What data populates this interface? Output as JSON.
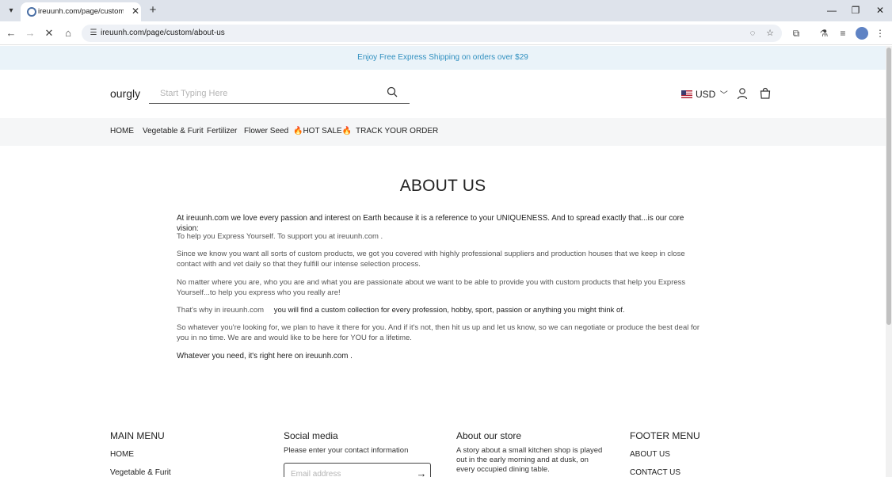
{
  "browser": {
    "tab_title": "ireuunh.com/page/custom/about-us",
    "url": "ireuunh.com/page/custom/about-us"
  },
  "announcement": "Enjoy Free Express Shipping on orders over $29",
  "header": {
    "logo": "ourgly",
    "search_placeholder": "Start Typing Here",
    "currency": "USD"
  },
  "nav": {
    "items": [
      "HOME",
      "Vegetable & Furit",
      "Fertilizer",
      "Flower Seed",
      "🔥HOT SALE🔥",
      "TRACK YOUR ORDER"
    ]
  },
  "about": {
    "title": "ABOUT US",
    "p1": "At ireuunh.com    we love every passion and interest on Earth because it is a reference to your UNIQUENESS.  And to spread exactly that...is  our core vision:",
    "p2": "To help you Express Yourself. To support you at ireuunh.com  .",
    "p3": "Since we know you want all sorts of custom products, we got  you covered with highly professional suppliers and production houses that we keep in close contact with and vet daily so that they fulfill our intense selection process.",
    "p4": "No matter where you are, who you are and what you are passionate about we want to be able to provide you with custom products that help you Express Yourself...to help you express who you really are!",
    "p5_prefix": "That's why in ireuunh.com",
    "p5_rest": "you will find a custom collection for every profession, hobby, sport, passion or anything you might think of.",
    "p6": "So whatever you're looking for, we plan to have it there for you. And if it's not, then hit us up and let us know, so we can negotiate or produce the best deal for you in no time. We are and would like to be here for YOU for a lifetime.",
    "p7": "Whatever you need, it's right here on ireuunh.com  ."
  },
  "footer": {
    "main_menu": {
      "title": "MAIN MENU",
      "items": [
        "HOME",
        "Vegetable & Furit"
      ]
    },
    "social": {
      "title": "Social media",
      "text": "Please enter your contact information",
      "email_placeholder": "Email address"
    },
    "about_store": {
      "title": "About our store",
      "text": "A story about a small kitchen shop is played out in the early morning and at dusk, on every occupied dining table."
    },
    "footer_menu": {
      "title": "FOOTER MENU",
      "items": [
        "ABOUT US",
        "CONTACT US"
      ]
    }
  }
}
